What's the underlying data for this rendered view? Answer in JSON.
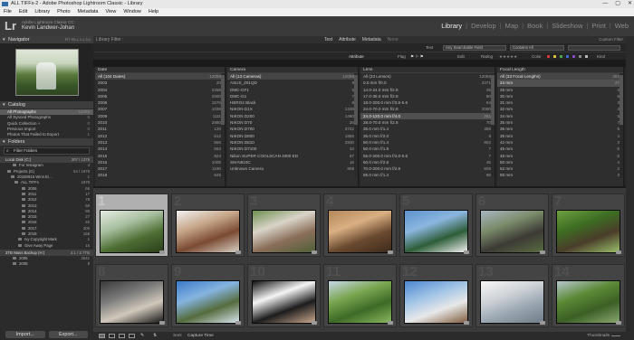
{
  "window": {
    "title": "ALL TIFFs-2 - Adobe Photoshop Lightroom Classic - Library",
    "controls": [
      "—",
      "▢",
      "✕"
    ]
  },
  "menu": [
    "File",
    "Edit",
    "Library",
    "Photo",
    "Metadata",
    "View",
    "Window",
    "Help"
  ],
  "identity": {
    "logo": "Lr",
    "product": "Adobe Lightroom Classic CC",
    "user": "Kevin Landwer-Johan"
  },
  "modules": [
    "Library",
    "Develop",
    "Map",
    "Book",
    "Slideshow",
    "Print",
    "Web"
  ],
  "active_module": "Library",
  "left": {
    "navigator_label": "Navigator",
    "navigator_options": "FIT  FILL  1:1  3:1",
    "catalog_label": "Catalog",
    "catalog": [
      {
        "label": "All Photographs",
        "count": "12058"
      },
      {
        "label": "All Synced Photographs",
        "count": "0"
      },
      {
        "label": "Quick Collection +",
        "count": "0"
      },
      {
        "label": "Previous Import",
        "count": "0"
      },
      {
        "label": "Photos That Failed to Export",
        "count": "1"
      }
    ],
    "folders_label": "Folders",
    "filter_folders": "Filter Folders",
    "volume1": {
      "label": "Local Disk (C:)",
      "count": "307 / 1378"
    },
    "folders1": [
      {
        "label": "For Instagram",
        "count": "4"
      },
      {
        "label": "Projects (G)",
        "count": "54 / 1978"
      },
      {
        "label": "20180916 Wins Ei…",
        "count": "1"
      },
      {
        "label": "ALL TIFFs",
        "count": "1879"
      },
      {
        "label": "2006",
        "count": "66"
      },
      {
        "label": "2011",
        "count": "17"
      },
      {
        "label": "2012",
        "count": "78"
      },
      {
        "label": "2013",
        "count": "59"
      },
      {
        "label": "2014",
        "count": "89"
      },
      {
        "label": "2015",
        "count": "27"
      },
      {
        "label": "2016",
        "count": "46"
      },
      {
        "label": "2017",
        "count": "305"
      },
      {
        "label": "2018",
        "count": "158"
      },
      {
        "label": "Ivy Copyright Mark",
        "count": "1"
      },
      {
        "label": "Give Away Page",
        "count": "16"
      }
    ],
    "volume2": {
      "label": "3TB Mass Backup (H:)",
      "count": "2.1 / 2.7TB"
    },
    "folders2": [
      {
        "label": "2006",
        "count": "2541"
      },
      {
        "label": "2008",
        "count": "8"
      }
    ],
    "import_label": "Import...",
    "export_label": "Export..."
  },
  "filterbar": {
    "header": "Library Filter :",
    "tabs": [
      "Text",
      "Attribute",
      "Metadata",
      "None"
    ],
    "preset": "Custom Filter",
    "text_label": "Text",
    "text_field": "Any Searchable Field",
    "text_rule": "Contains All",
    "attribute_label": "Attribute",
    "flag_label": "Flag",
    "edit_label": "Edit",
    "rating_label": "Rating",
    "color_label": "Color",
    "kind_label": "Kind",
    "swatch_colors": [
      "#d23a3a",
      "#d8c43a",
      "#4aa84a",
      "#3a6ad2",
      "#8a4ac8",
      "#888888",
      "#bbbbbb"
    ]
  },
  "columns": [
    {
      "header": "Date",
      "rows": [
        {
          "label": "All (104 Dates)",
          "count": "12058"
        },
        {
          "label": "2003",
          "count": "20"
        },
        {
          "label": "2004",
          "count": "2258"
        },
        {
          "label": "2005",
          "count": "2500"
        },
        {
          "label": "2006",
          "count": "1576"
        },
        {
          "label": "2007",
          "count": "1038"
        },
        {
          "label": "2009",
          "count": "1111"
        },
        {
          "label": "2010",
          "count": "2880"
        },
        {
          "label": "2011",
          "count": "120"
        },
        {
          "label": "2012",
          "count": "612"
        },
        {
          "label": "2013",
          "count": "550"
        },
        {
          "label": "2014",
          "count": "593"
        },
        {
          "label": "2015",
          "count": "824"
        },
        {
          "label": "2016",
          "count": "1005"
        },
        {
          "label": "2017",
          "count": "1190"
        },
        {
          "label": "2018",
          "count": "645"
        }
      ]
    },
    {
      "header": "Camera",
      "rows": [
        {
          "label": "All (13 Cameras)",
          "count": "12058"
        },
        {
          "label": "ASUS_Z01QD",
          "count": "9"
        },
        {
          "label": "DMC-GF1",
          "count": "5"
        },
        {
          "label": "DMC-G1",
          "count": "7"
        },
        {
          "label": "HERO4 Black",
          "count": "8"
        },
        {
          "label": "NIKON D1X",
          "count": "1338"
        },
        {
          "label": "NIKON D200",
          "count": "1480"
        },
        {
          "label": "NIKON D70",
          "count": "26"
        },
        {
          "label": "NIKON D700",
          "count": "3722"
        },
        {
          "label": "NIKON D800",
          "count": "1859"
        },
        {
          "label": "NIKON D810",
          "count": "2830"
        },
        {
          "label": "NIKON D7100",
          "count": "43"
        },
        {
          "label": "Nikon SUPER COOLSCAN 4000 ED",
          "count": "87"
        },
        {
          "label": "SM-N910C",
          "count": "16"
        },
        {
          "label": "Unknown Camera",
          "count": "808"
        }
      ]
    },
    {
      "header": "Lens",
      "rows": [
        {
          "label": "All (33 Lenses)",
          "count": "12058"
        },
        {
          "label": "0.0 mm f/0.0",
          "count": "2371"
        },
        {
          "label": "14.0-24.0 mm f/2.8",
          "count": "25"
        },
        {
          "label": "17.0-35.0 mm f/2.8",
          "count": "80"
        },
        {
          "label": "18.0-200.0 mm f/3.5-5.6",
          "count": "64"
        },
        {
          "label": "24.0-70.0 mm f/2.8",
          "count": "2080"
        },
        {
          "label": "24.0-120.0 mm f/4.0",
          "count": "281"
        },
        {
          "label": "28.0-70.0 mm f/2.8",
          "count": "70"
        },
        {
          "label": "35.0 mm f/1.4",
          "count": "388"
        },
        {
          "label": "35.0 mm f/2.0",
          "count": "8"
        },
        {
          "label": "50.0 mm f/1.4",
          "count": "802"
        },
        {
          "label": "50.0 mm f/1.8",
          "count": "7"
        },
        {
          "label": "55.0-200.0 mm f/4.0-5.6",
          "count": "7"
        },
        {
          "label": "60.0 mm f/2.8",
          "count": "45"
        },
        {
          "label": "70.0-200.0 mm f/2.8",
          "count": "805"
        },
        {
          "label": "85.0 mm f/1.4",
          "count": "98"
        }
      ]
    },
    {
      "header": "Focal Length",
      "rows": [
        {
          "label": "All (33 Focal Lengths)",
          "count": "281"
        },
        {
          "label": "24 mm",
          "count": "27"
        },
        {
          "label": "28 mm",
          "count": "2"
        },
        {
          "label": "30 mm",
          "count": "6"
        },
        {
          "label": "31 mm",
          "count": "3"
        },
        {
          "label": "32 mm",
          "count": "4"
        },
        {
          "label": "34 mm",
          "count": "5"
        },
        {
          "label": "35 mm",
          "count": "7"
        },
        {
          "label": "36 mm",
          "count": "5"
        },
        {
          "label": "38 mm",
          "count": "4"
        },
        {
          "label": "42 mm",
          "count": "3"
        },
        {
          "label": "45 mm",
          "count": "5"
        },
        {
          "label": "48 mm",
          "count": "6"
        },
        {
          "label": "50 mm",
          "count": "4"
        },
        {
          "label": "52 mm",
          "count": "2"
        },
        {
          "label": "55 mm",
          "count": "3"
        }
      ]
    }
  ],
  "grid": [
    {
      "num": "1",
      "name": "waterfall",
      "colors": [
        "#e5ece2",
        "#a8bfa0",
        "#4d6e33",
        "#2a3d1b"
      ]
    },
    {
      "num": "2",
      "name": "portrait-street",
      "colors": [
        "#f1f1f1",
        "#c7a78a",
        "#7a4a32",
        "#d8d0c5"
      ]
    },
    {
      "num": "3",
      "name": "group-outdoors",
      "colors": [
        "#6d8f4f",
        "#d9d4c8",
        "#8a6e5a",
        "#4d6036"
      ]
    },
    {
      "num": "4",
      "name": "woman-interior",
      "colors": [
        "#b28759",
        "#d9b083",
        "#6a4a30",
        "#3d2a1b"
      ]
    },
    {
      "num": "5",
      "name": "coastline",
      "colors": [
        "#5d93cc",
        "#8cb6df",
        "#2d5d38",
        "#f2f2f2"
      ]
    },
    {
      "num": "6",
      "name": "man-field",
      "colors": [
        "#a8b7c2",
        "#7b8b6a",
        "#3c3a35",
        "#5a6d41"
      ]
    },
    {
      "num": "7",
      "name": "hobbit-house",
      "colors": [
        "#6fa040",
        "#3d6d22",
        "#4a3d2a",
        "#9ac06a"
      ]
    },
    {
      "num": "8",
      "name": "photographer-car",
      "colors": [
        "#3a3a3a",
        "#7a7a7a",
        "#d0c8bb",
        "#151515"
      ]
    },
    {
      "num": "9",
      "name": "landscape-sky",
      "colors": [
        "#3b7ac8",
        "#86b4e0",
        "#556c3d",
        "#d9e4ee"
      ]
    },
    {
      "num": "10",
      "name": "studio-portrait",
      "colors": [
        "#101010",
        "#f5f5f5",
        "#1c1c1c",
        "#c9a98f"
      ]
    },
    {
      "num": "11",
      "name": "rice-field",
      "colors": [
        "#c8d8e8",
        "#7aa650",
        "#3d6a26",
        "#8cb760"
      ]
    },
    {
      "num": "12",
      "name": "temple-sky",
      "colors": [
        "#4c86cf",
        "#9ec2e6",
        "#e8e8e8",
        "#7d5b3c"
      ]
    },
    {
      "num": "13",
      "name": "white-temple",
      "colors": [
        "#f6f6f6",
        "#d0d4d8",
        "#9aa6b1",
        "#6f7d88"
      ]
    },
    {
      "num": "14",
      "name": "terraces",
      "colors": [
        "#b7c7cf",
        "#5c8a36",
        "#3b5f25",
        "#8aa870"
      ]
    }
  ],
  "toolbar": {
    "sort_label": "Sort:",
    "sort_value": "Capture Time",
    "thumbnails_label": "Thumbnails"
  }
}
